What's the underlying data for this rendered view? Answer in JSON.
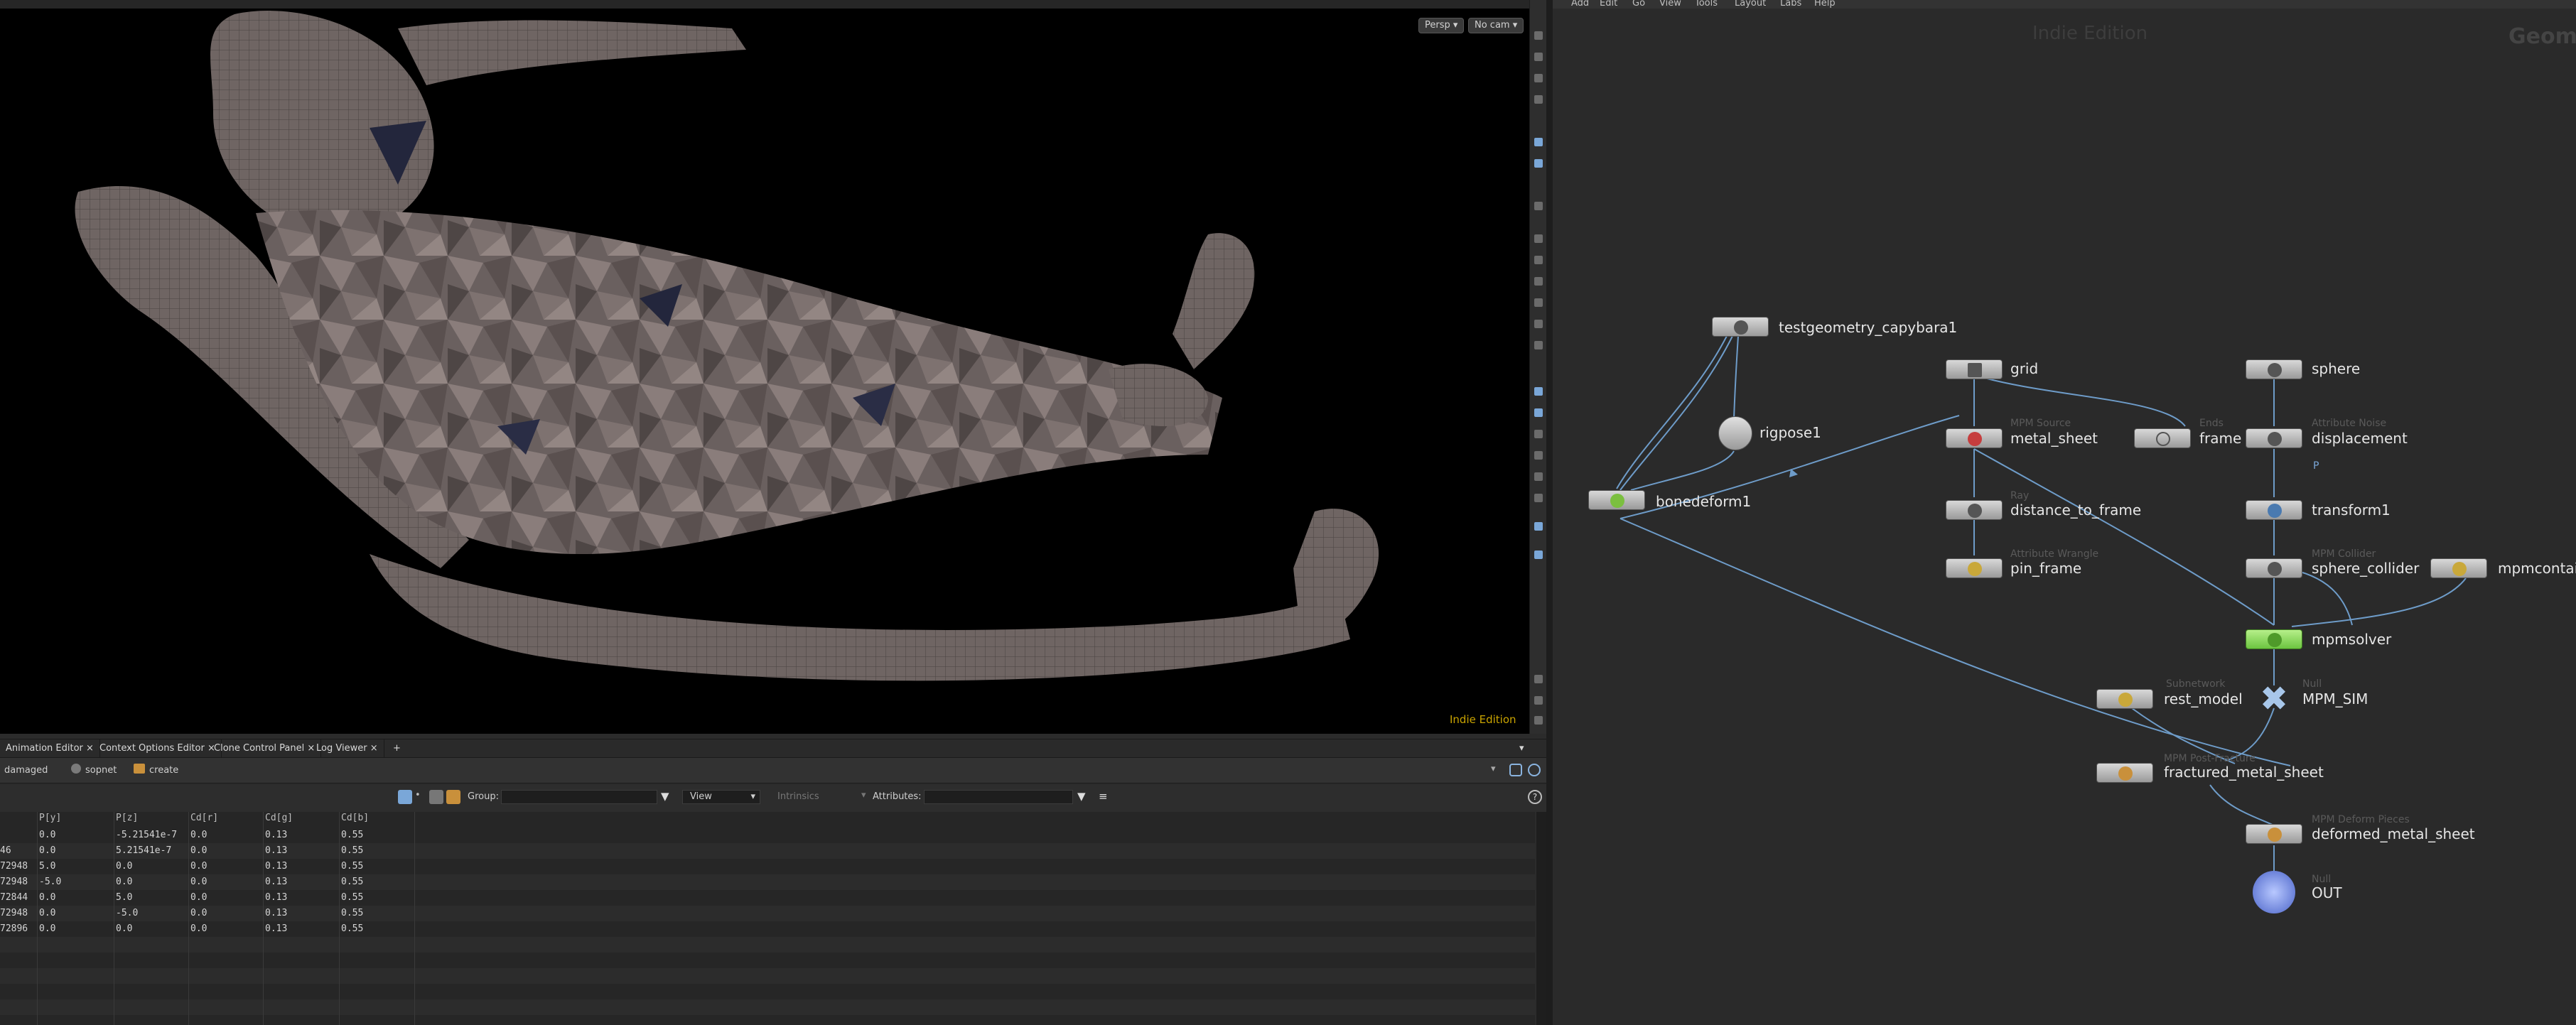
{
  "viewport": {
    "camera_view_label": "Persp",
    "camera_label": "No cam",
    "watermark": "Indie Edition"
  },
  "panel_tabs": [
    {
      "label": "Animation Editor"
    },
    {
      "label": "Context Options Editor"
    },
    {
      "label": "Clone Control Panel"
    },
    {
      "label": "Log Viewer"
    }
  ],
  "path": {
    "items": [
      "damaged",
      "sopnet",
      "create"
    ]
  },
  "spreadsheet": {
    "group_label": "Group:",
    "view_label": "View",
    "intrinsics_label": "Intrinsics",
    "attributes_label": "Attributes:",
    "columns": [
      "P[y]",
      "P[z]",
      "Cd[r]",
      "Cd[g]",
      "Cd[b]"
    ],
    "rows": [
      {
        "px": "",
        "py": "0.0",
        "pz": "-5.21541e-7",
        "r": "0.0",
        "g": "0.13",
        "b": "0.55"
      },
      {
        "px": "46",
        "py": "0.0",
        "pz": "5.21541e-7",
        "r": "0.0",
        "g": "0.13",
        "b": "0.55"
      },
      {
        "px": "72948",
        "py": "5.0",
        "pz": "0.0",
        "r": "0.0",
        "g": "0.13",
        "b": "0.55"
      },
      {
        "px": "72948",
        "py": "-5.0",
        "pz": "0.0",
        "r": "0.0",
        "g": "0.13",
        "b": "0.55"
      },
      {
        "px": "72844",
        "py": "0.0",
        "pz": "5.0",
        "r": "0.0",
        "g": "0.13",
        "b": "0.55"
      },
      {
        "px": "72948",
        "py": "0.0",
        "pz": "-5.0",
        "r": "0.0",
        "g": "0.13",
        "b": "0.55"
      },
      {
        "px": "72896",
        "py": "0.0",
        "pz": "0.0",
        "r": "0.0",
        "g": "0.13",
        "b": "0.55"
      }
    ]
  },
  "network": {
    "menu": [
      "Add",
      "Edit",
      "Go",
      "View",
      "Tools",
      "Layout",
      "Labs",
      "Help"
    ],
    "watermark": "Indie Edition",
    "context_label": "Geom",
    "nodes": {
      "testgeometry": {
        "name": "testgeometry_capybara1",
        "type": ""
      },
      "rigpose": {
        "name": "rigpose1",
        "type": ""
      },
      "bonedeform": {
        "name": "bonedeform1",
        "type": ""
      },
      "grid": {
        "name": "grid",
        "type": ""
      },
      "metal_sheet": {
        "name": "metal_sheet",
        "type": "MPM Source"
      },
      "frame": {
        "name": "frame",
        "type": "Ends"
      },
      "distance_to_frame": {
        "name": "distance_to_frame",
        "type": "Ray"
      },
      "pin_frame": {
        "name": "pin_frame",
        "type": "Attribute Wrangle"
      },
      "sphere": {
        "name": "sphere",
        "type": ""
      },
      "displacement": {
        "name": "displacement",
        "type": "Attribute Noise"
      },
      "transform": {
        "name": "transform1",
        "type": ""
      },
      "sphere_collider": {
        "name": "sphere_collider",
        "type": "MPM Collider"
      },
      "mpmcontainer": {
        "name": "mpmcontain",
        "type": ""
      },
      "mpmsolver": {
        "name": "mpmsolver",
        "type": ""
      },
      "rest_model": {
        "name": "rest_model",
        "type": "Subnetwork"
      },
      "mpm_sim": {
        "name": "MPM_SIM",
        "type": "Null"
      },
      "fractured": {
        "name": "fractured_metal_sheet",
        "type": "MPM Post-Fracture"
      },
      "deformed": {
        "name": "deformed_metal_sheet",
        "type": "MPM Deform Pieces"
      },
      "out": {
        "name": "OUT",
        "type": "Null"
      }
    },
    "displacement_flag": "P"
  },
  "colors": {
    "accent": "#7aa7d8",
    "solver_node": "#8fe060",
    "wire": "#6e9cc9",
    "watermark": "#c9a300"
  }
}
